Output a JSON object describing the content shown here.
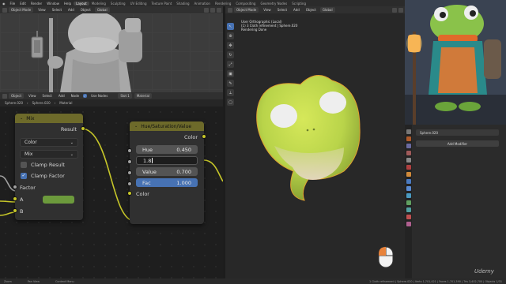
{
  "menu": [
    "File",
    "Edit",
    "Render",
    "Window",
    "Help"
  ],
  "workspaces": [
    "Layout",
    "Modeling",
    "Sculpting",
    "UV Editing",
    "Texture Paint",
    "Shading",
    "Animation",
    "Rendering",
    "Compositing",
    "Geometry Nodes",
    "Scripting"
  ],
  "active_workspace": "Layout",
  "viewport_left_header": {
    "mode": "Object Mode",
    "items": [
      "View",
      "Select",
      "Add",
      "Object"
    ],
    "orientation": "Global"
  },
  "viewport_main_header": {
    "mode": "Object Mode",
    "items": [
      "View",
      "Select",
      "Add",
      "Object"
    ],
    "orientation": "Global"
  },
  "node_editor_header": {
    "type": "Object",
    "items": [
      "View",
      "Select",
      "Add",
      "Node"
    ],
    "use_nodes": "Use Nodes",
    "slot": "Slot 1",
    "material": "Material"
  },
  "breadcrumb": [
    "Sphere.020",
    "Sphere.020",
    "Material"
  ],
  "overlay": {
    "line1": "User Orthographic (Local)",
    "line2": "(1) 3 Cloth refinement | Sphere.020",
    "line3": "Rendering Done"
  },
  "mix_node": {
    "title": "Mix",
    "output_label": "Result",
    "data_type": "Color",
    "blend_mode": "Mix",
    "clamp_result_label": "Clamp Result",
    "clamp_result": false,
    "clamp_factor_label": "Clamp Factor",
    "clamp_factor": true,
    "factor_label": "Factor",
    "a_label": "A",
    "b_label": "B",
    "a_color": "#6c9a3c"
  },
  "hsv_node": {
    "title": "Hue/Saturation/Value",
    "output_label": "Color",
    "hue_label": "Hue",
    "hue_value": "0.450",
    "saturation_editing": "1.8",
    "value_label": "Value",
    "value_value": "0.700",
    "fac_label": "Fac",
    "fac_value": "1.000",
    "input_label": "Color"
  },
  "properties": {
    "object_name": "Sphere.020",
    "add_modifier": "Add Modifier"
  },
  "status_bar": {
    "left": [
      "Zoom",
      "Pan View",
      "Context Menu"
    ],
    "right": "1 Cloth refinement | Sphere.020 | Verts 1,701,421 | Faces 1,701,390 | Tris 3,402,700 | Objects 1/31"
  },
  "watermark": "Udemy",
  "colors": {
    "node_header": "#6d6a2a",
    "socket_color": "#c7c729",
    "accent_blue": "#4772b3",
    "frog_green": "#b9d44a"
  }
}
